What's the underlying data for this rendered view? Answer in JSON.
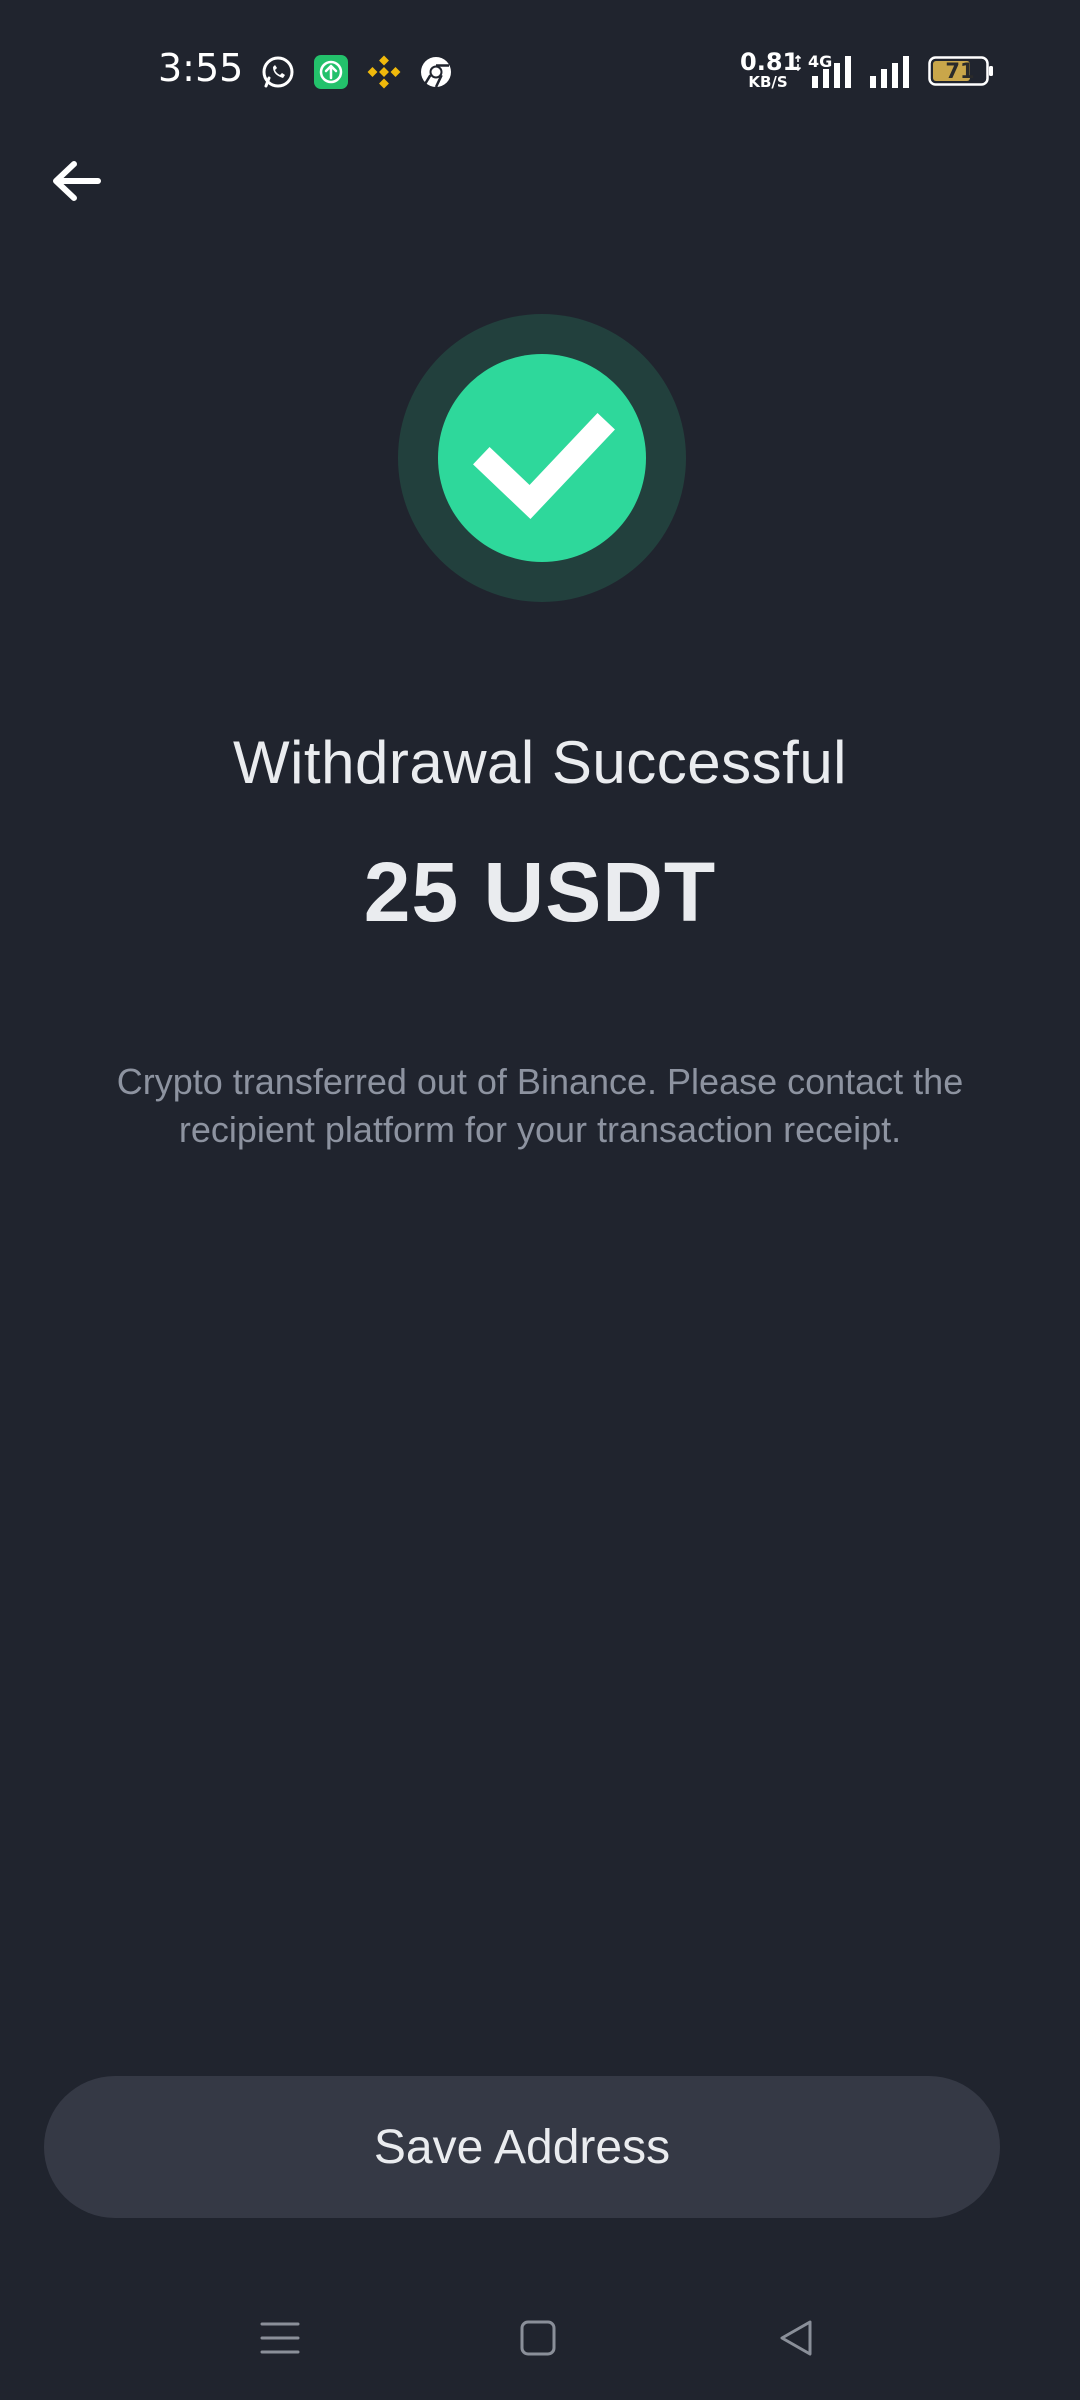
{
  "status_bar": {
    "time": "3:55",
    "net_speed_value": "0.81",
    "net_speed_unit": "KB/S",
    "network_type": "4G",
    "battery_level": "71",
    "app_icons": [
      "whatsapp-icon",
      "upload-app-icon",
      "binance-icon",
      "chrome-icon"
    ]
  },
  "header": {
    "back_icon": "arrow-left-icon"
  },
  "result": {
    "icon": "checkmark-icon",
    "title": "Withdrawal Successful",
    "amount": "25 USDT",
    "description": "Crypto transferred out of Binance. Please contact the recipient platform for your transaction receipt."
  },
  "actions": {
    "save_address_label": "Save Address"
  },
  "nav": {
    "icons": [
      "menu-icon",
      "home-icon",
      "back-triangle-icon"
    ]
  },
  "colors": {
    "background": "#20242e",
    "success_green": "#2ed89b",
    "success_ring": "#22403d",
    "button_bg": "#353945",
    "text_primary": "#eaecef",
    "text_secondary": "#8d93a0",
    "binance_yellow": "#f0b90b"
  }
}
